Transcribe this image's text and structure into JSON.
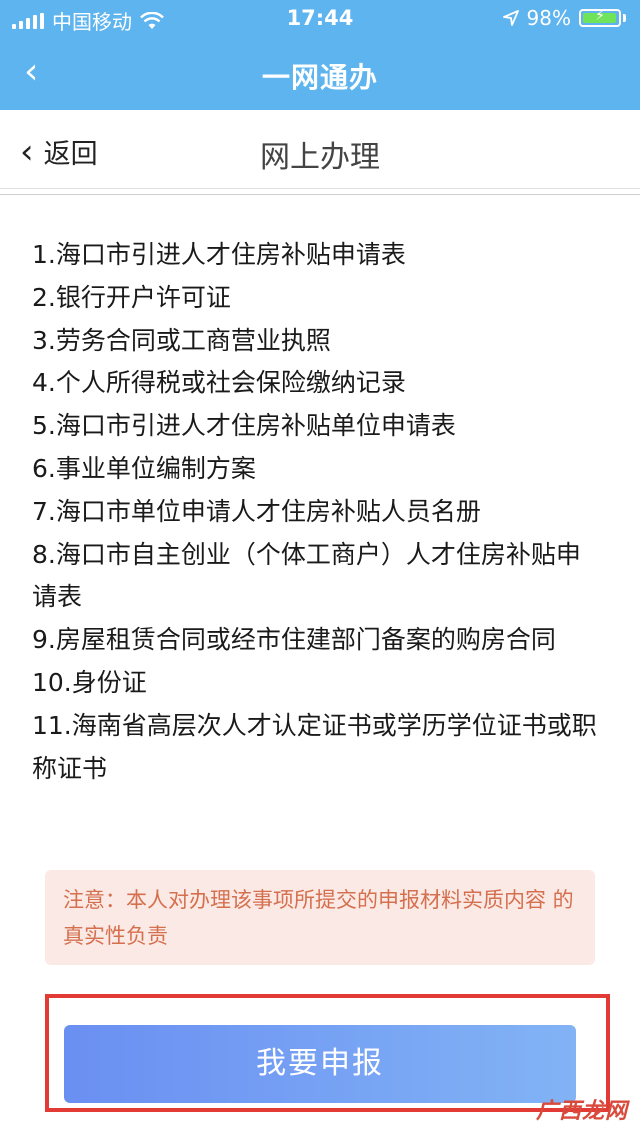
{
  "status_bar": {
    "carrier": "中国移动",
    "time": "17:44",
    "battery_percent": "98%",
    "battery_level": 0.98,
    "icons": [
      "signal-icon",
      "wifi-icon",
      "location-icon",
      "battery-icon"
    ]
  },
  "nav": {
    "back_glyph": "‹",
    "title": "一网通办"
  },
  "subheader": {
    "back_glyph": "‹",
    "back_label": "返回",
    "title": "网上办理"
  },
  "materials": [
    "1.海口市引进人才住房补贴申请表",
    "2.银行开户许可证",
    "3.劳务合同或工商营业执照",
    "4.个人所得税或社会保险缴纳记录",
    "5.海口市引进人才住房补贴单位申请表",
    "6.事业单位编制方案",
    "7.海口市单位申请人才住房补贴人员名册",
    "8.海口市自主创业（个体工商户）人才住房补贴申请表",
    "9.房屋租赁合同或经市住建部门备案的购房合同",
    "10.身份证",
    "11.海南省高层次人才认定证书或学历学位证书或职称证书"
  ],
  "notice": "注意：本人对办理该事项所提交的申报材料实质内容 的真实性负责",
  "submit_label": "我要申报",
  "watermark": "广西龙网",
  "colors": {
    "header_blue": "#5eb4ee",
    "button_gradient_start": "#6a8ff2",
    "button_gradient_end": "#82b3f5",
    "notice_bg": "#fbe9e6",
    "notice_text": "#d5704e",
    "highlight_frame": "#e23b36"
  }
}
